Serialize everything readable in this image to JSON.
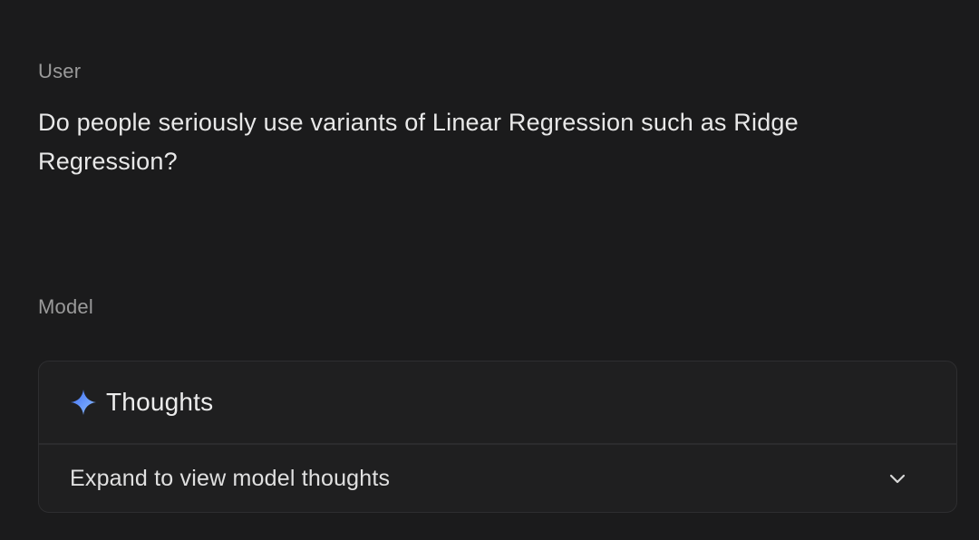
{
  "turns": {
    "user": {
      "role_label": "User",
      "message": "Do people seriously use variants of Linear Regression such as Ridge Regression?"
    },
    "model": {
      "role_label": "Model",
      "thoughts": {
        "icon": "sparkle-icon",
        "title": "Thoughts",
        "expand_label": "Expand to view model thoughts",
        "chevron_icon": "chevron-down-icon"
      }
    }
  },
  "colors": {
    "background": "#1b1b1c",
    "card_background": "#1f1f20",
    "sparkle_gradient_start": "#4f7cff",
    "sparkle_gradient_end": "#7fb6ff"
  }
}
